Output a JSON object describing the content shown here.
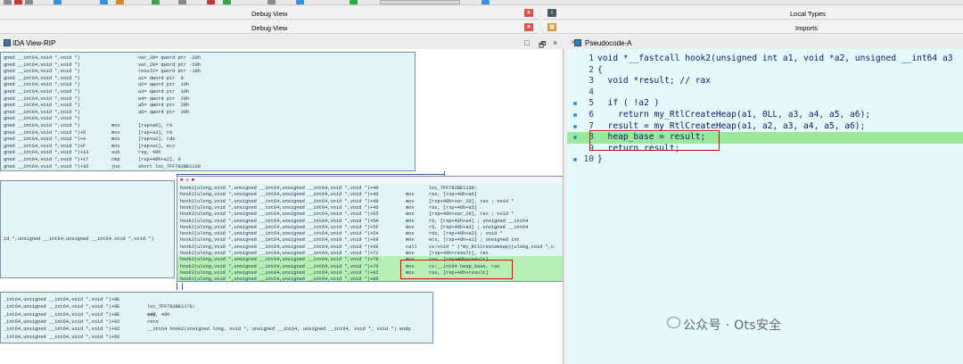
{
  "tabs": {
    "debug_view_1": "Debug View",
    "debug_view_2": "Debug View",
    "local_types": "Local Types",
    "imports": "Imports"
  },
  "ida_view": {
    "title": "IDA View-RIP",
    "controls": [
      "□",
      "🗗",
      "×"
    ]
  },
  "pseudocode": {
    "title": "Pseudocode-A",
    "close": "×",
    "lines": [
      {
        "num": "1",
        "text": "void *__fastcall hook2(unsigned int a1, void *a2, unsigned __int64 a3"
      },
      {
        "num": "2",
        "text": "{"
      },
      {
        "num": "3",
        "text": "  void *result; // rax"
      },
      {
        "num": "4",
        "text": ""
      },
      {
        "num": "5",
        "text": "  if ( !a2 )"
      },
      {
        "num": "6",
        "text": "    return my_RtlCreateHeap(a1, 0LL, a3, a4, a5, a6);"
      },
      {
        "num": "7",
        "text": "  result = my_RtlCreateHeap(a1, a2, a3, a4, a5, a6);"
      },
      {
        "num": "8",
        "text": "  heap_base = result;"
      },
      {
        "num": "9",
        "text": "  return result;"
      },
      {
        "num": "10",
        "text": "}"
      }
    ]
  },
  "node_top": [
    [
      "gned __int64,void *,void *)",
      "",
      "var_28= qword ptr -28h"
    ],
    [
      "gned __int64,void *,void *)",
      "",
      "var_20= qword ptr -20h"
    ],
    [
      "gned __int64,void *,void *)",
      "",
      "result= qword ptr -18h"
    ],
    [
      "gned __int64,void *,void *)",
      "",
      "a1= dword ptr  8"
    ],
    [
      "gned __int64,void *,void *)",
      "",
      "a2= qword ptr  10h"
    ],
    [
      "gned __int64,void *,void *)",
      "",
      "a3= qword ptr  18h"
    ],
    [
      "gned __int64,void *,void *)",
      "",
      "a4= qword ptr  20h"
    ],
    [
      "gned __int64,void *,void *)",
      "",
      "a5= qword ptr  28h"
    ],
    [
      "gned __int64,void *,void *)",
      "",
      "a6= qword ptr  30h"
    ],
    [
      "gned __int64,void *,void *)",
      "",
      ""
    ],
    [
      "gned __int64,void *,void *)",
      "mov",
      "[rsp+a6], r9"
    ],
    [
      "gned __int64,void *,void *)+5",
      "mov",
      "[rsp+a3], r8"
    ],
    [
      "gned __int64,void *,void *)+A",
      "mov",
      "[rsp+a2], rdx"
    ],
    [
      "gned __int64,void *,void *)+F",
      "mov",
      "[rsp+a1], ecx"
    ],
    [
      "gned __int64,void *,void *)+13",
      "sub",
      "rsp, 48h"
    ],
    [
      "gned __int64,void *,void *)+17",
      "cmp",
      "[rsp+48h+a2], 0"
    ],
    [
      "gned __int64,void *,void *)+1D",
      "jnz",
      "short loc_7FF782BE1130"
    ]
  ],
  "node_mid_header": "■ ◎ ■",
  "node_mid": [
    [
      "hook2(ulong,void *,unsigned __int64,unsigned __int64,void *,void *)+40",
      "",
      "loc_7FF782BE1130:"
    ],
    [
      "hook2(ulong,void *,unsigned __int64,unsigned __int64,void *,void *)+40",
      "mov",
      "rax, [rsp+48h+a6]"
    ],
    [
      "hook2(ulong,void *,unsigned __int64,unsigned __int64,void *,void *)+48",
      "mov",
      "[rsp+48h+var_20], rax ; void *"
    ],
    [
      "hook2(ulong,void *,unsigned __int64,unsigned __int64,void *,void *)+4D",
      "mov",
      "rax, [rsp+48h+a5]"
    ],
    [
      "hook2(ulong,void *,unsigned __int64,unsigned __int64,void *,void *)+55",
      "mov",
      "[rsp+48h+var_28], rax ; void *"
    ],
    [
      "hook2(ulong,void *,unsigned __int64,unsigned __int64,void *,void *)+5A",
      "mov",
      "r9, [rsp+48h+a4] ; unsigned __int64"
    ],
    [
      "hook2(ulong,void *,unsigned __int64,unsigned __int64,void *,void *)+5F",
      "mov",
      "r8, [rsp+48h+a3] ; unsigned __int64"
    ],
    [
      "hook2(ulong,void *,unsigned __int64,unsigned __int64,void *,void *)+64",
      "mov",
      "rdx, [rsp+48h+a2] ; void *"
    ],
    [
      "hook2(ulong,void *,unsigned __int64,unsigned __int64,void *,void *)+69",
      "mov",
      "ecx, [rsp+48h+a1] ; unsigned int"
    ],
    [
      "hook2(ulong,void *,unsigned __int64,unsigned __int64,void *,void *)+6E",
      "call",
      "cs:void * (*my_RtlCreateHeap)(ulong,void *,u"
    ],
    [
      "hook2(ulong,void *,unsigned __int64,unsigned __int64,void *,void *)+72",
      "mov",
      "[rsp+48h+result], rax"
    ],
    [
      "hook2(ulong,void *,unsigned __int64,unsigned __int64,void *,void *)+78",
      "mov",
      "rax, [rsp+48h+result]"
    ],
    [
      "hook2(ulong,void *,unsigned __int64,unsigned __int64,void *,void *)+7D",
      "mov",
      "cs:__int64 heap_base, rax"
    ],
    [
      "hook2(ulong,void *,unsigned __int64,unsigned __int64,void *,void *)+82",
      "mov",
      "rax, [rsp+48h+result]"
    ],
    [
      "hook2(ulong,void *,unsigned __int64,unsigned __int64,void *,void *)+89",
      "",
      ""
    ]
  ],
  "node_left": "id *,unsigned __int64,unsigned __int64,void *,void *)",
  "node_bottom": [
    [
      "_int64,unsigned __int64,void *,void *)+8E",
      "",
      ""
    ],
    [
      "_int64,unsigned __int64,void *,void *)+8E",
      "loc_7FF782BE1176:",
      ""
    ],
    [
      "_int64,unsigned __int64,void *,void *)+8E",
      "add",
      "rsp, 48h"
    ],
    [
      "_int64,unsigned __int64,void *,void *)+92",
      "retn",
      ""
    ],
    [
      "_int64,unsigned __int64,void *,void *)+92",
      "",
      "__int64 hook2(unsigned long, void *, unsigned __int64, unsigned __int64, void *, void *) endp"
    ],
    [
      "_int64,unsigned __int64,void *,void *)+92",
      "",
      ""
    ]
  ],
  "watermark": "公众号 · Ots安全"
}
